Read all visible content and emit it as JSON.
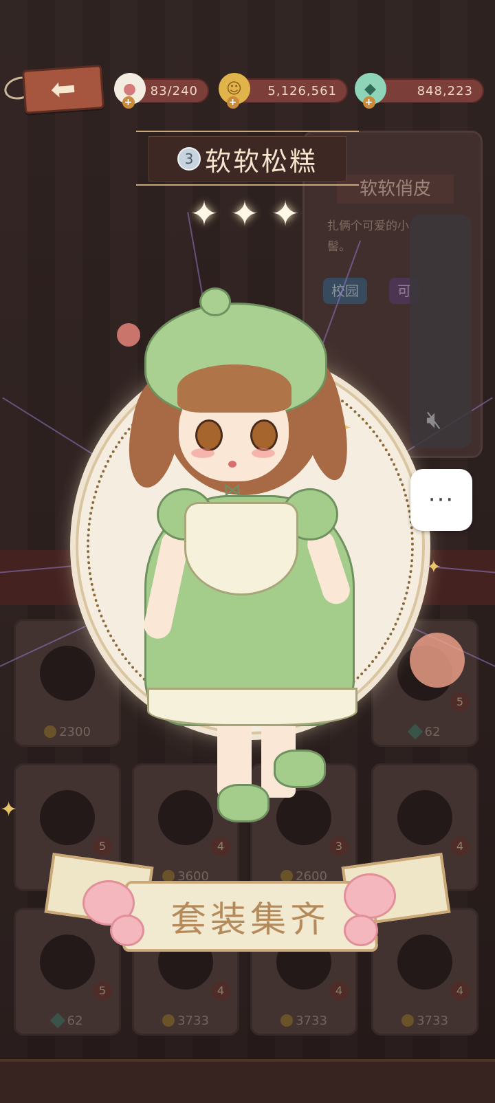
{
  "header": {
    "resources": [
      {
        "name": "cake",
        "value": "83/240"
      },
      {
        "name": "coin",
        "value": "5,126,561"
      },
      {
        "name": "gem",
        "value": "848,223"
      }
    ]
  },
  "outfit": {
    "number": "3",
    "title": "软软松糕",
    "stars": [
      "✦",
      "✦",
      "✦"
    ]
  },
  "info_card": {
    "title": "软软俏皮",
    "description": "扎俩个可爱的小髻。",
    "tags": [
      "校园",
      "可"
    ]
  },
  "grid": {
    "prices": [
      "2300",
      "62",
      "3600",
      "2600",
      "62",
      "3733",
      "3733",
      "3733"
    ],
    "badges": [
      "5",
      "5",
      "4",
      "3",
      "4",
      "5",
      "4",
      "4",
      "4"
    ]
  },
  "banner": {
    "text": "套装集齐"
  },
  "system": {
    "more_button": "···"
  },
  "colors": {
    "accent_green": "#a4cc8b",
    "banner_text": "#b48a5a",
    "title_text": "#f4e4cd"
  }
}
